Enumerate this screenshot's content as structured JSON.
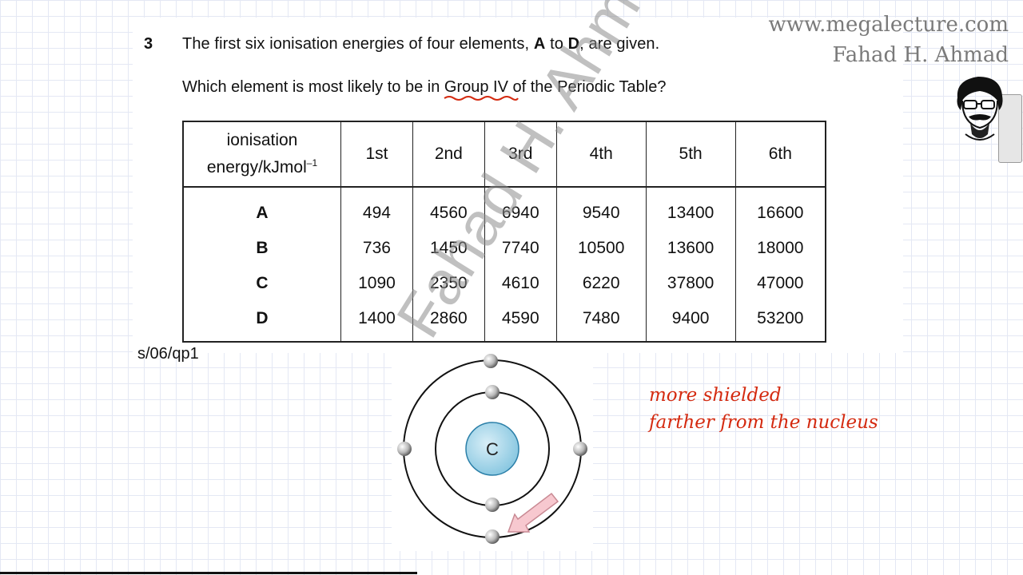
{
  "header": {
    "site": "www.megalecture.com",
    "author": "Fahad H. Ahmad"
  },
  "watermark": "Fahad H. Ahmad",
  "question": {
    "number": "3",
    "line1_pre": "The first six ionisation energies of four elements, ",
    "line1_a": "A",
    "line1_mid": " to ",
    "line1_d": "D",
    "line1_post": ", are given.",
    "line2_pre": "Which element is most likely to be in ",
    "line2_group": "Group IV",
    "line2_post": " of the Periodic Table?"
  },
  "table": {
    "header_label_1": "ionisation",
    "header_label_2": "energy/kJ",
    "header_label_3": "mol",
    "header_label_sup": "–1",
    "columns": [
      "1st",
      "2nd",
      "3rd",
      "4th",
      "5th",
      "6th"
    ],
    "rows": [
      {
        "element": "A",
        "values": [
          "494",
          "4560",
          "6940",
          "9540",
          "13400",
          "16600"
        ]
      },
      {
        "element": "B",
        "values": [
          "736",
          "1450",
          "7740",
          "10500",
          "13600",
          "18000"
        ]
      },
      {
        "element": "C",
        "values": [
          "1090",
          "2350",
          "4610",
          "6220",
          "37800",
          "47000"
        ]
      },
      {
        "element": "D",
        "values": [
          "1400",
          "2860",
          "4590",
          "7480",
          "9400",
          "53200"
        ]
      }
    ]
  },
  "source_ref": "s/06/qp1",
  "diagram": {
    "nucleus_label": "C"
  },
  "handwritten_notes": {
    "line1": "more shielded",
    "line2": "farther from the nucleus"
  },
  "colors": {
    "ink_red": "#d42a10",
    "nucleus_fill": "#9fd3e8",
    "arrow_fill": "#f7c8cf"
  }
}
